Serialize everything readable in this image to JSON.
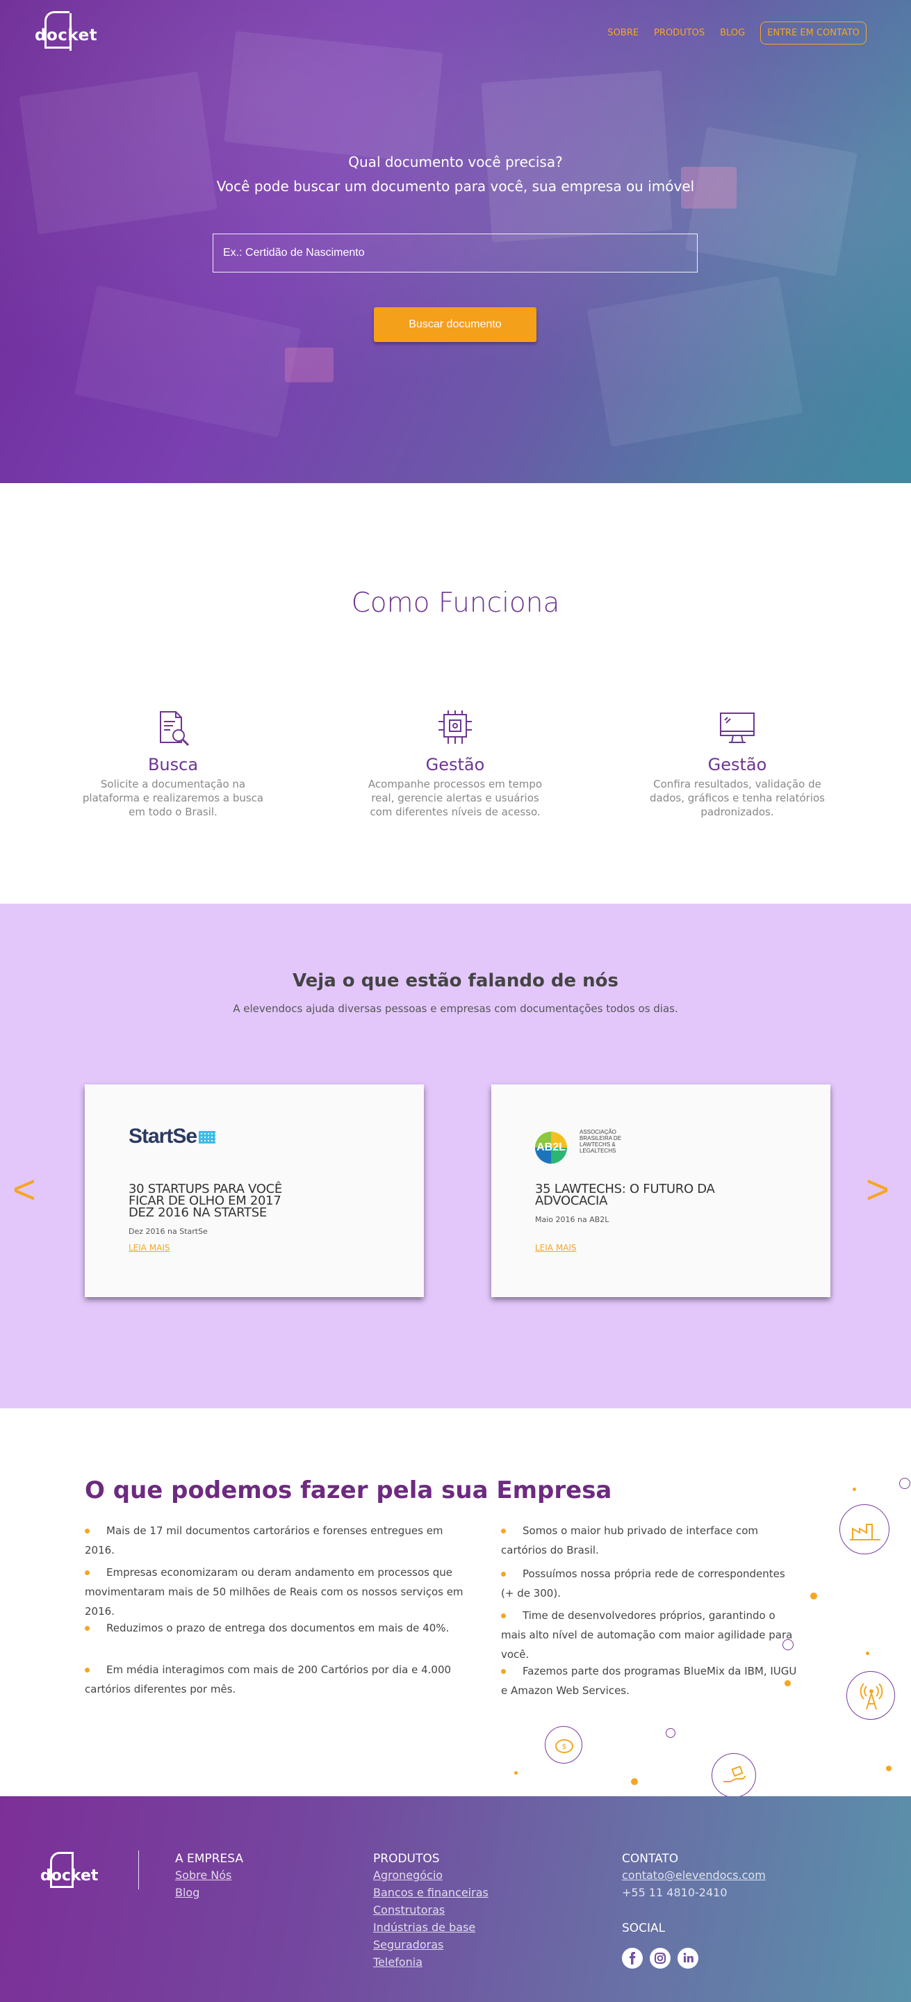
{
  "brand": {
    "logo_text": "docket"
  },
  "nav": {
    "items": [
      "SOBRE",
      "PRODUTOS",
      "BLOG"
    ],
    "cta": "ENTRE EM CONTATO"
  },
  "hero": {
    "question": "Qual documento você precisa?",
    "subtitle": "Você pode buscar um documento para você, sua empresa ou imóvel",
    "search_placeholder": "Ex.: Certidão de Nascimento",
    "button": "Buscar documento"
  },
  "como_funciona": {
    "title": "Como Funciona",
    "features": [
      {
        "icon": "document-search-icon",
        "title": "Busca",
        "text": "Solicite a documentação na plataforma e realizaremos a busca em todo o Brasil."
      },
      {
        "icon": "processor-chip-icon",
        "title": "Gestão",
        "text": "Acompanhe processos em tempo real, gerencie alertas e usuários com diferentes níveis de acesso."
      },
      {
        "icon": "monitor-icon",
        "title": "Gestão",
        "text": "Confira resultados, validação de dados, gráficos e tenha relatórios padronizados."
      }
    ]
  },
  "press": {
    "title": "Veja o que estão falando de nós",
    "subtitle": "A elevendocs ajuda diversas pessoas e empresas com documentações todos os dias.",
    "prev": "<",
    "next": ">",
    "cards": [
      {
        "logo": "StartSe",
        "title": "30 STARTUPS PARA VOCÊ FICAR DE OLHO EM 2017 Dez 2016 na StartSe",
        "date": "Dez 2016 na StartSe",
        "more": "LEIA MAIS"
      },
      {
        "logo": "AB2L",
        "logo_caption": "ASSOCIAÇÃO BRASILEIRA DE LAWTECHS & LEGALTECHS",
        "title": "35 LAWTECHS: O FUTURO DA ADVOCACIA",
        "date": "Maio 2016 na AB2L",
        "more": "LEIA MAIS"
      }
    ]
  },
  "empresa": {
    "title": "O que podemos fazer pela sua Empresa",
    "left": [
      "Mais de 17 mil documentos cartorários e forenses entregues em 2016.",
      "Empresas economizaram ou deram andamento em processos que movimentaram mais de 50 milhões de Reais com os nossos serviços em 2016.",
      "Reduzimos o prazo de entrega dos documentos em mais de 40%.",
      "Em média interagimos com mais de 200 Cartórios por dia e 4.000 cartórios diferentes por mês."
    ],
    "right": [
      "Somos o maior hub privado de interface com cartórios do Brasil.",
      "Possuímos nossa própria rede de correspondentes (+ de 300).",
      "Time de desenvolvedores próprios, garantindo o mais alto nível de automação com maior agilidade para você.",
      "Fazemos parte dos programas BlueMix da IBM, IUGU e Amazon Web Services."
    ]
  },
  "footer": {
    "logo_text": "docket",
    "empresa": {
      "heading": "A EMPRESA",
      "links": [
        "Sobre Nós",
        "Blog"
      ]
    },
    "produtos": {
      "heading": "PRODUTOS",
      "links": [
        "Agronegócio",
        "Bancos e financeiras",
        "Construtoras",
        "Indústrias de base",
        "Seguradoras",
        "Telefonia"
      ]
    },
    "contato": {
      "heading": "CONTATO",
      "email": "contato@elevendocs.com",
      "phone": "+55 11 4810-2410"
    },
    "social": {
      "heading": "SOCIAL",
      "networks": [
        "facebook-icon",
        "instagram-icon",
        "linkedin-icon"
      ]
    }
  },
  "colors": {
    "accent": "#f5a623",
    "brand_purple": "#6d3592",
    "press_bg": "#e3c7fb"
  }
}
